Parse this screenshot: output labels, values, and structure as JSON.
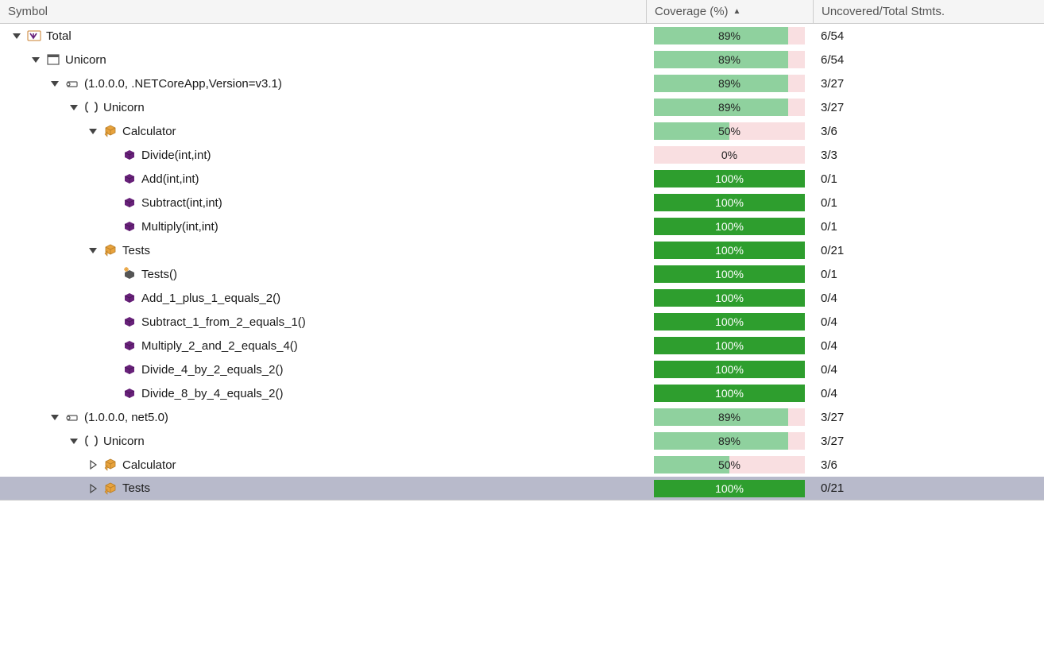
{
  "headers": {
    "symbol": "Symbol",
    "coverage": "Coverage (%)",
    "stmts": "Uncovered/Total Stmts."
  },
  "rows": [
    {
      "indent": 0,
      "expander": "expanded",
      "icon": "vs",
      "label": "Total",
      "pct": 89,
      "stmts": "6/54",
      "selected": false
    },
    {
      "indent": 1,
      "expander": "expanded",
      "icon": "project",
      "label": "Unicorn",
      "pct": 89,
      "stmts": "6/54",
      "selected": false
    },
    {
      "indent": 2,
      "expander": "expanded",
      "icon": "assembly",
      "label": "(1.0.0.0, .NETCoreApp,Version=v3.1)",
      "pct": 89,
      "stmts": "3/27",
      "selected": false
    },
    {
      "indent": 3,
      "expander": "expanded",
      "icon": "namespace",
      "label": "Unicorn",
      "pct": 89,
      "stmts": "3/27",
      "selected": false
    },
    {
      "indent": 4,
      "expander": "expanded",
      "icon": "class",
      "label": "Calculator",
      "pct": 50,
      "stmts": "3/6",
      "selected": false
    },
    {
      "indent": 5,
      "expander": "none",
      "icon": "method",
      "label": "Divide(int,int)",
      "pct": 0,
      "stmts": "3/3",
      "selected": false
    },
    {
      "indent": 5,
      "expander": "none",
      "icon": "method",
      "label": "Add(int,int)",
      "pct": 100,
      "stmts": "0/1",
      "selected": false
    },
    {
      "indent": 5,
      "expander": "none",
      "icon": "method",
      "label": "Subtract(int,int)",
      "pct": 100,
      "stmts": "0/1",
      "selected": false
    },
    {
      "indent": 5,
      "expander": "none",
      "icon": "method",
      "label": "Multiply(int,int)",
      "pct": 100,
      "stmts": "0/1",
      "selected": false
    },
    {
      "indent": 4,
      "expander": "expanded",
      "icon": "class",
      "label": "Tests",
      "pct": 100,
      "stmts": "0/21",
      "selected": false
    },
    {
      "indent": 5,
      "expander": "none",
      "icon": "ctor",
      "label": "Tests()",
      "pct": 100,
      "stmts": "0/1",
      "selected": false
    },
    {
      "indent": 5,
      "expander": "none",
      "icon": "method",
      "label": "Add_1_plus_1_equals_2()",
      "pct": 100,
      "stmts": "0/4",
      "selected": false
    },
    {
      "indent": 5,
      "expander": "none",
      "icon": "method",
      "label": "Subtract_1_from_2_equals_1()",
      "pct": 100,
      "stmts": "0/4",
      "selected": false
    },
    {
      "indent": 5,
      "expander": "none",
      "icon": "method",
      "label": "Multiply_2_and_2_equals_4()",
      "pct": 100,
      "stmts": "0/4",
      "selected": false
    },
    {
      "indent": 5,
      "expander": "none",
      "icon": "method",
      "label": "Divide_4_by_2_equals_2()",
      "pct": 100,
      "stmts": "0/4",
      "selected": false
    },
    {
      "indent": 5,
      "expander": "none",
      "icon": "method",
      "label": "Divide_8_by_4_equals_2()",
      "pct": 100,
      "stmts": "0/4",
      "selected": false
    },
    {
      "indent": 2,
      "expander": "expanded",
      "icon": "assembly",
      "label": "(1.0.0.0, net5.0)",
      "pct": 89,
      "stmts": "3/27",
      "selected": false
    },
    {
      "indent": 3,
      "expander": "expanded",
      "icon": "namespace",
      "label": "Unicorn",
      "pct": 89,
      "stmts": "3/27",
      "selected": false
    },
    {
      "indent": 4,
      "expander": "collapsed",
      "icon": "class",
      "label": "Calculator",
      "pct": 50,
      "stmts": "3/6",
      "selected": false
    },
    {
      "indent": 4,
      "expander": "collapsed",
      "icon": "class",
      "label": "Tests",
      "pct": 100,
      "stmts": "0/21",
      "selected": true
    }
  ]
}
